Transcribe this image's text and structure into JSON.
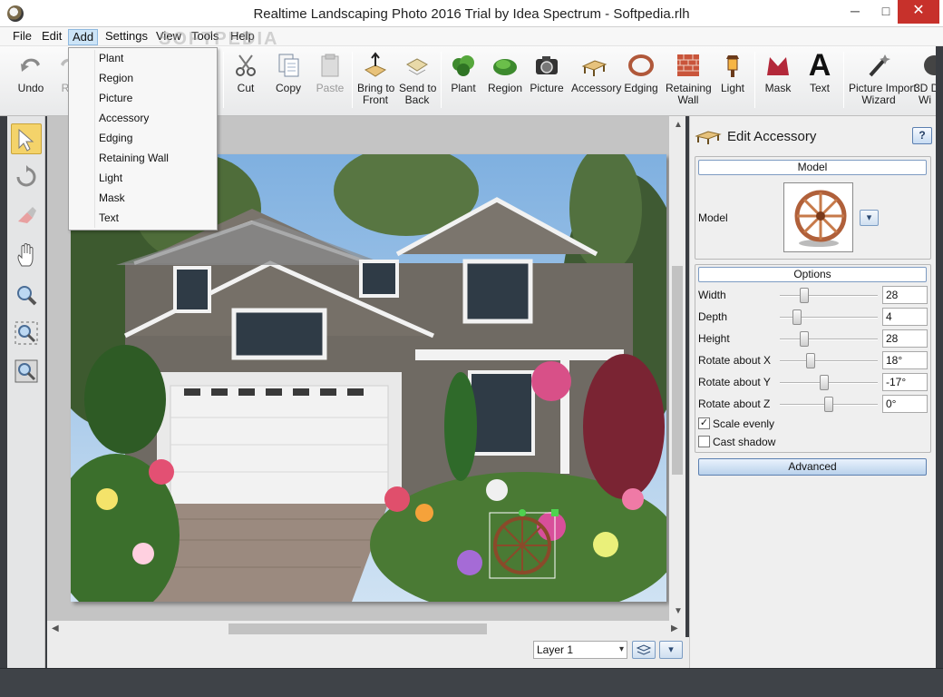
{
  "window": {
    "title": "Realtime Landscaping Photo 2016 Trial by Idea Spectrum - Softpedia.rlh",
    "minimize": "─",
    "maximize": "□",
    "close": "✕"
  },
  "watermark": "SOFTPEDIA",
  "menu": [
    "File",
    "Edit",
    "Add",
    "Settings",
    "View",
    "Tools",
    "Help"
  ],
  "toolbar": {
    "undo": "Undo",
    "redo": "R",
    "cut": "Cut",
    "copy": "Copy",
    "paste": "Paste",
    "bring_front": [
      "Bring to",
      "Front"
    ],
    "send_back": [
      "Send to",
      "Back"
    ],
    "plant": "Plant",
    "region": "Region",
    "picture": "Picture",
    "accessory": "Accessory",
    "edging": "Edging",
    "retaining_wall": [
      "Retaining",
      "Wall"
    ],
    "light": "Light",
    "mask": "Mask",
    "text": "Text",
    "text_icon": "A",
    "picture_import": [
      "Picture Import",
      "Wizard"
    ],
    "wizard3d": [
      "3D D",
      "Wi"
    ]
  },
  "add_menu": [
    "Plant",
    "Region",
    "Picture",
    "Accessory",
    "Edging",
    "Retaining Wall",
    "Light",
    "Mask",
    "Text"
  ],
  "left_tools": [
    "select-arrow-icon",
    "rotate-icon",
    "eraser-icon",
    "hand-pan-icon",
    "zoom-in-icon",
    "zoom-fit-icon",
    "zoom-out-icon"
  ],
  "bottom": {
    "layer": "Layer 1",
    "dropdown_glyph": "▾"
  },
  "panel": {
    "title": "Edit Accessory",
    "help": "?",
    "model_group": "Model",
    "model_label": "Model",
    "options_group": "Options",
    "options": [
      {
        "label": "Width",
        "value": "28",
        "level": 0.22
      },
      {
        "label": "Depth",
        "value": "4",
        "level": 0.14
      },
      {
        "label": "Height",
        "value": "28",
        "level": 0.22
      },
      {
        "label": "Rotate about X",
        "value": "18°",
        "level": 0.3
      },
      {
        "label": "Rotate about Y",
        "value": "-17°",
        "level": 0.45
      },
      {
        "label": "Rotate about Z",
        "value": "0°",
        "level": 0.5
      }
    ],
    "scale_evenly": {
      "label": "Scale evenly",
      "checked": true,
      "mark": "✓"
    },
    "cast_shadow": {
      "label": "Cast shadow",
      "checked": false,
      "mark": ""
    },
    "advanced": "Advanced"
  },
  "colors": {
    "accent": "#cce4f7",
    "selected_tool": "#f4d36a",
    "close_button": "#c7312b"
  }
}
